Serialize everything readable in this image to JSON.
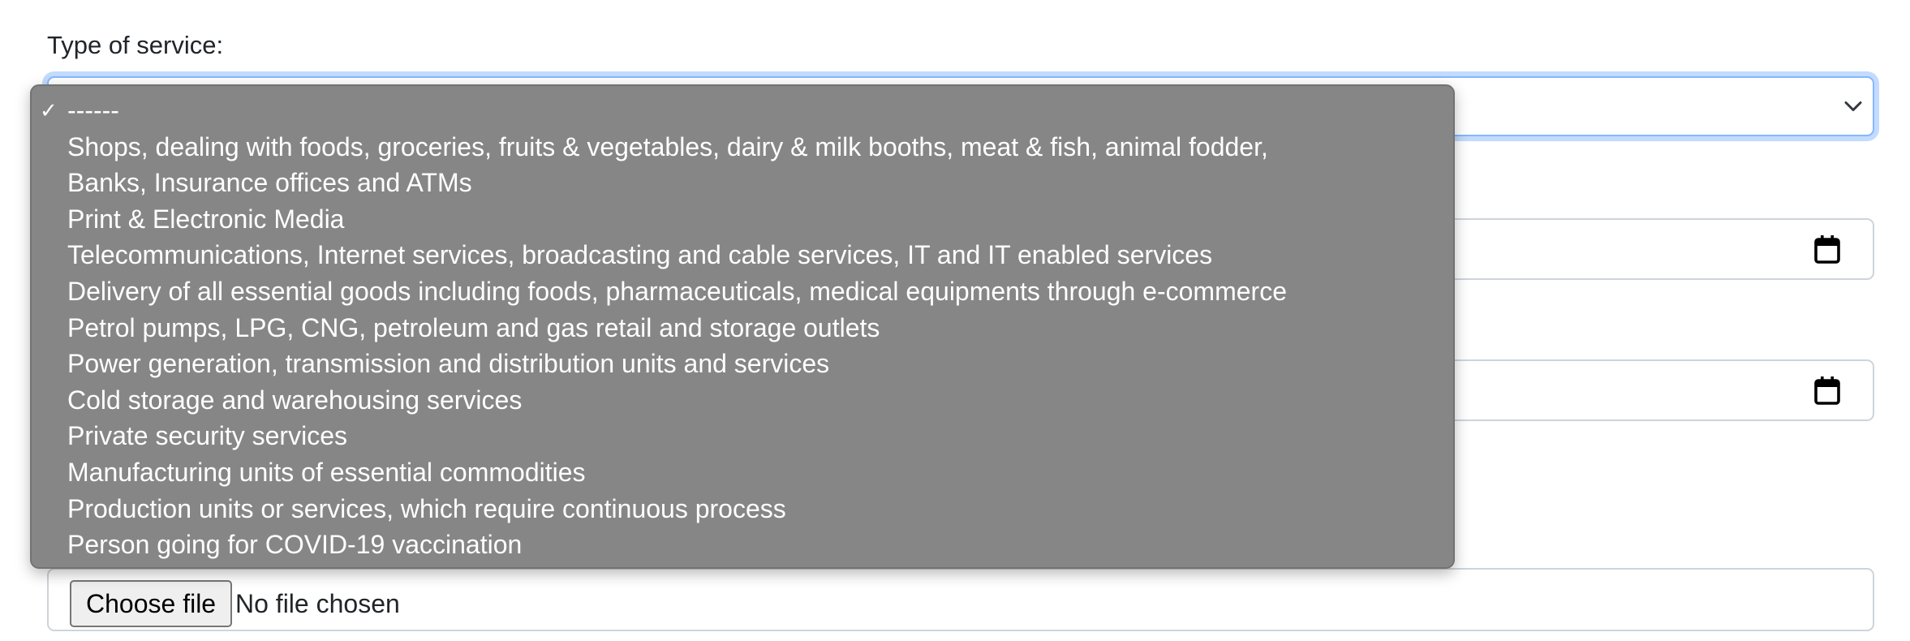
{
  "form": {
    "service_label": "Type of service:",
    "service_selected": "------",
    "file_button_label": "Choose file",
    "file_status": "No file chosen"
  },
  "dropdown": {
    "selected_index": 0,
    "options": [
      "------",
      "Shops, dealing with foods, groceries, fruits & vegetables, dairy & milk booths, meat & fish, animal fodder,",
      "Banks, Insurance offices and ATMs",
      "Print & Electronic Media",
      "Telecommunications, Internet services, broadcasting and cable services, IT and IT enabled services",
      "Delivery of all essential goods including foods, pharmaceuticals, medical equipments through e-commerce",
      "Petrol pumps, LPG, CNG, petroleum and gas retail and storage outlets",
      "Power generation, transmission and distribution units and services",
      "Cold storage and warehousing services",
      "Private security services",
      "Manufacturing units of essential commodities",
      "Production units or services, which require continuous process",
      "Person going for COVID-19 vaccination"
    ]
  },
  "icons": {
    "check": "checkmark-icon",
    "chevron": "chevron-down-icon",
    "calendar": "calendar-icon"
  },
  "colors": {
    "dropdown_bg": "#868686",
    "focus_border": "#86b7fe",
    "input_border": "#ced4da",
    "text": "#212529"
  }
}
